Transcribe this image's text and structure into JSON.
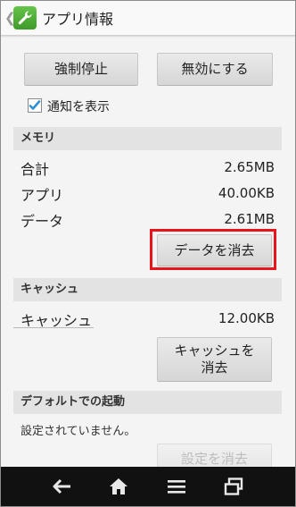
{
  "header": {
    "title": "アプリ情報",
    "back_glyph": "❮",
    "icon": "wrench-icon"
  },
  "actions": {
    "force_stop_label": "強制停止",
    "disable_label": "無効にする"
  },
  "notifications": {
    "label": "通知を表示",
    "checked": true
  },
  "memory": {
    "section_title": "メモリ",
    "rows": [
      {
        "label": "合計",
        "value": "2.65MB"
      },
      {
        "label": "アプリ",
        "value": "40.00KB"
      },
      {
        "label": "データ",
        "value": "2.61MB"
      }
    ],
    "clear_data_label": "データを消去"
  },
  "cache": {
    "section_title": "キャッシュ",
    "row": {
      "label": "キャッシュ",
      "value": "12.00KB"
    },
    "clear_cache_label": "キャッシュを\n消去"
  },
  "defaults": {
    "section_title": "デフォルトでの起動",
    "note": "設定されていません。",
    "clear_defaults_label": "設定を消去"
  },
  "navbar": {
    "icons": [
      "back-icon",
      "home-icon",
      "menu-icon",
      "recent-apps-icon"
    ]
  },
  "colors": {
    "highlight": "#e8141b",
    "check_accent": "#2d8fd5",
    "navbar": "#111111"
  }
}
